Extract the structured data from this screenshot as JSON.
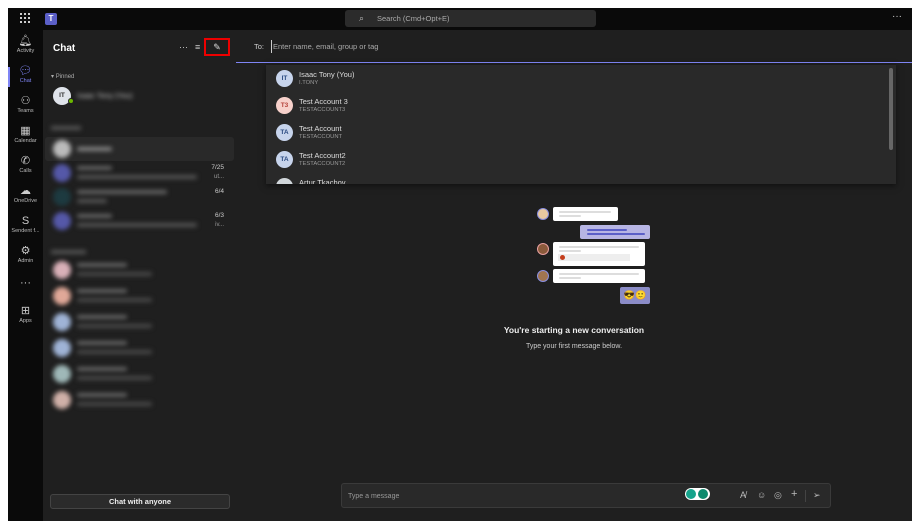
{
  "topbar": {
    "search_placeholder": "Search (Cmd+Opt+E)",
    "more": "···",
    "logo": "T"
  },
  "rail": {
    "items": [
      {
        "label": "Activity",
        "icon": "bell-icon",
        "glyph": "🔔︎"
      },
      {
        "label": "Chat",
        "icon": "chat-icon",
        "glyph": "💬︎",
        "active": true
      },
      {
        "label": "Teams",
        "icon": "teams-icon",
        "glyph": "⚇"
      },
      {
        "label": "Calendar",
        "icon": "calendar-icon",
        "glyph": "▦"
      },
      {
        "label": "Calls",
        "icon": "phone-icon",
        "glyph": "✆"
      },
      {
        "label": "OneDrive",
        "icon": "cloud-icon",
        "glyph": "☁"
      },
      {
        "label": "Sendent f...",
        "icon": "sendent-icon",
        "glyph": "S"
      },
      {
        "label": "Admin",
        "icon": "admin-icon",
        "glyph": "⚙"
      },
      {
        "label": "",
        "icon": "more-icon",
        "glyph": "···"
      },
      {
        "label": "Apps",
        "icon": "apps-icon",
        "glyph": "⊞"
      }
    ]
  },
  "chatlist": {
    "title": "Chat",
    "more": "···",
    "filter": "≡",
    "new_chat": "✎",
    "pinned_label": "Pinned",
    "pinned": {
      "initials": "IT",
      "name": "Isaac Tony (You)"
    },
    "recent": [
      {
        "date": "",
        "snippet": ""
      },
      {
        "date": "7/25",
        "snippet": "ut..."
      },
      {
        "date": "6/4",
        "snippet": ""
      },
      {
        "date": "6/3",
        "snippet": "iv..."
      }
    ],
    "chat_with_anyone": "Chat with anyone"
  },
  "compose_header": {
    "to_label": "To:",
    "placeholder": "Enter name, email, group or tag"
  },
  "suggestions": [
    {
      "initials": "IT",
      "name": "Isaac Tony (You)",
      "sub": "I.TONY",
      "bg": "#c7d4ec",
      "fg": "#2a4a80"
    },
    {
      "initials": "T3",
      "name": "Test Account 3",
      "sub": "TESTACCOUNT3",
      "bg": "#f7d1cb",
      "fg": "#b5433b"
    },
    {
      "initials": "TA",
      "name": "Test Account",
      "sub": "TESTACCOUNT",
      "bg": "#c7d4ec",
      "fg": "#2a4a80"
    },
    {
      "initials": "TA",
      "name": "Test Account2",
      "sub": "TESTACCOUNT2",
      "bg": "#c7d4ec",
      "fg": "#2a4a80"
    },
    {
      "initials": "",
      "name": "Artur Tkachov",
      "sub": "",
      "bg": "#d0d6da",
      "fg": "#444"
    }
  ],
  "empty_state": {
    "title": "You're starting a new conversation",
    "subtitle": "Type your first message below.",
    "emoji": "😎🙂"
  },
  "message": {
    "placeholder": "Type a message"
  },
  "colors": {
    "accent": "#7f85f5",
    "highlight": "#e00000"
  }
}
